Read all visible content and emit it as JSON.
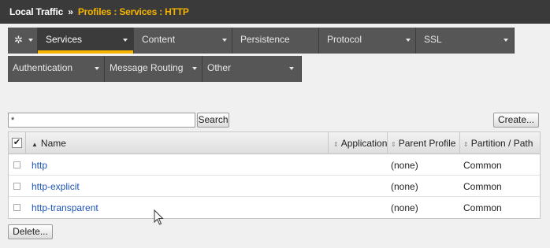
{
  "breadcrumb": {
    "root": "Local Traffic",
    "separator": "»",
    "current": "Profiles : Services : HTTP"
  },
  "tabs_row1": [
    {
      "label": "Services",
      "active": true
    },
    {
      "label": "Content"
    },
    {
      "label": "Persistence"
    },
    {
      "label": "Protocol"
    },
    {
      "label": "SSL"
    }
  ],
  "tabs_row2": [
    {
      "label": "Authentication"
    },
    {
      "label": "Message Routing"
    },
    {
      "label": "Other"
    }
  ],
  "search": {
    "value": "*",
    "button": "Search"
  },
  "create_button": "Create...",
  "delete_button": "Delete...",
  "table": {
    "headers": {
      "name": "Name",
      "application": "Application",
      "parent": "Parent Profile",
      "partition": "Partition / Path"
    },
    "rows": [
      {
        "name": "http",
        "application": "",
        "parent": "(none)",
        "partition": "Common"
      },
      {
        "name": "http-explicit",
        "application": "",
        "parent": "(none)",
        "partition": "Common"
      },
      {
        "name": "http-transparent",
        "application": "",
        "parent": "(none)",
        "partition": "Common"
      }
    ]
  },
  "colors": {
    "accent": "#f5b400",
    "tab_bg": "#565656",
    "link": "#1f55b8"
  }
}
